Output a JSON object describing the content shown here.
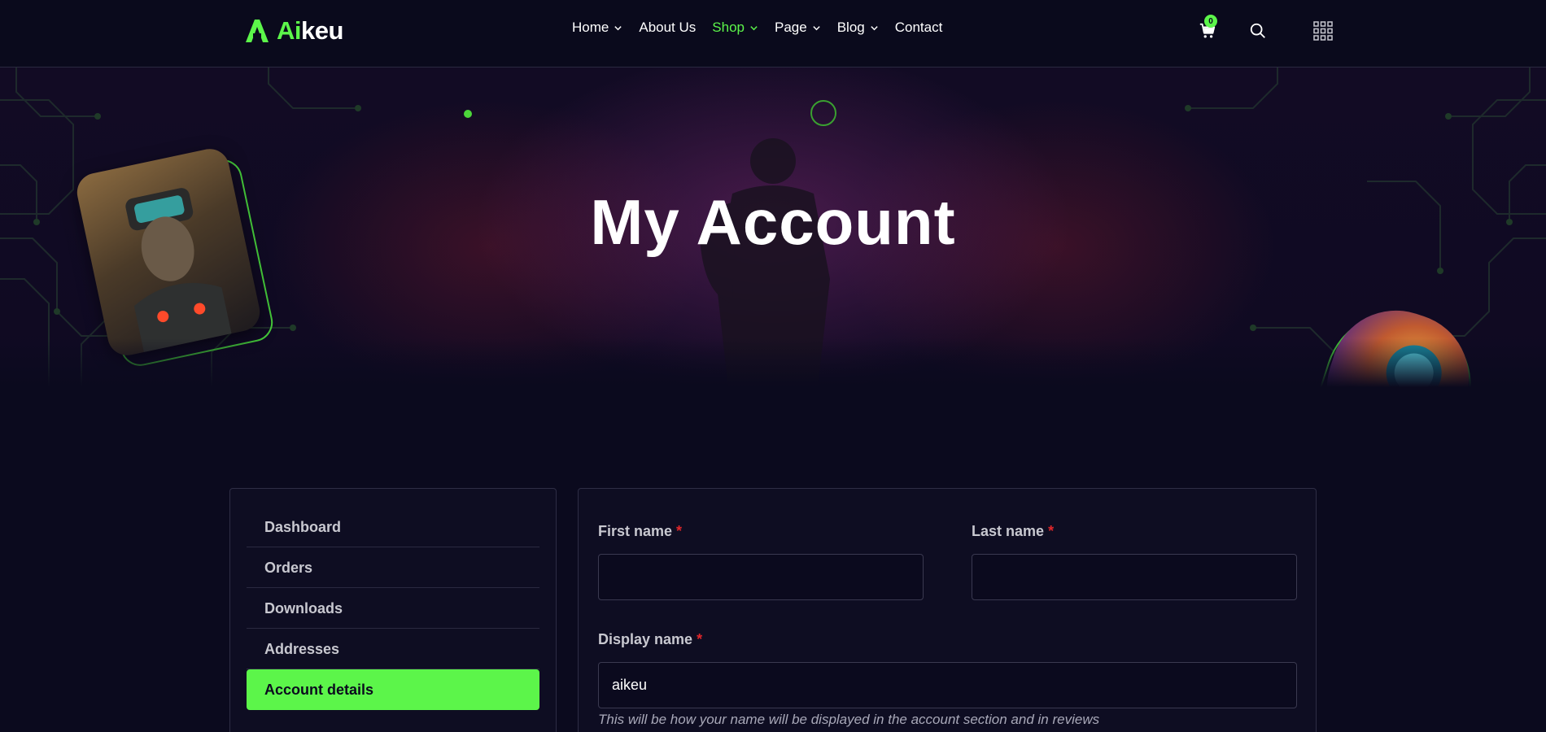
{
  "brand": {
    "logo_accent": "Ai",
    "logo_rest": "keu"
  },
  "nav": {
    "items": [
      {
        "label": "Home",
        "has_dropdown": true,
        "active": false
      },
      {
        "label": "About Us",
        "has_dropdown": false,
        "active": false
      },
      {
        "label": "Shop",
        "has_dropdown": true,
        "active": true
      },
      {
        "label": "Page",
        "has_dropdown": true,
        "active": false
      },
      {
        "label": "Blog",
        "has_dropdown": true,
        "active": false
      },
      {
        "label": "Contact",
        "has_dropdown": false,
        "active": false
      }
    ]
  },
  "header_icons": {
    "cart_count": "0",
    "cart_icon": "cart-icon",
    "search_icon": "search-icon",
    "menu_icon": "grid-menu-icon"
  },
  "hero": {
    "title": "My Account"
  },
  "account_nav": {
    "items": [
      {
        "label": "Dashboard",
        "active": false
      },
      {
        "label": "Orders",
        "active": false
      },
      {
        "label": "Downloads",
        "active": false
      },
      {
        "label": "Addresses",
        "active": false
      },
      {
        "label": "Account details",
        "active": true
      }
    ]
  },
  "form": {
    "first_name": {
      "label": "First name",
      "required_mark": "*",
      "value": ""
    },
    "last_name": {
      "label": "Last name",
      "required_mark": "*",
      "value": ""
    },
    "display_name": {
      "label": "Display name",
      "required_mark": "*",
      "value": "aikeu",
      "help": "This will be how your name will be displayed in the account section and in reviews"
    }
  },
  "colors": {
    "accent": "#5cf54a",
    "background": "#0b0a1e",
    "required": "#e0262a"
  }
}
